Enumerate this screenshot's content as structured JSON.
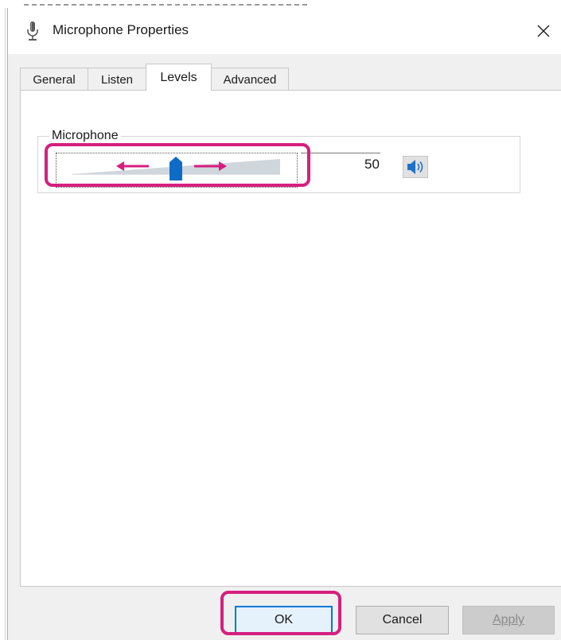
{
  "window": {
    "title": "Microphone Properties",
    "icon": "microphone-icon",
    "close_glyph": "✕"
  },
  "tabs": [
    {
      "label": "General",
      "active": false
    },
    {
      "label": "Listen",
      "active": false
    },
    {
      "label": "Levels",
      "active": true
    },
    {
      "label": "Advanced",
      "active": false
    }
  ],
  "levels": {
    "group_label": "Microphone",
    "value": "50",
    "slider_fraction": 0.5,
    "speaker_icon": "speaker-icon"
  },
  "buttons": {
    "ok": "OK",
    "cancel": "Cancel",
    "apply": "Apply"
  },
  "colors": {
    "highlight": "#d61f7f",
    "accent": "#0078d7",
    "arrow": "#d61f7f"
  }
}
